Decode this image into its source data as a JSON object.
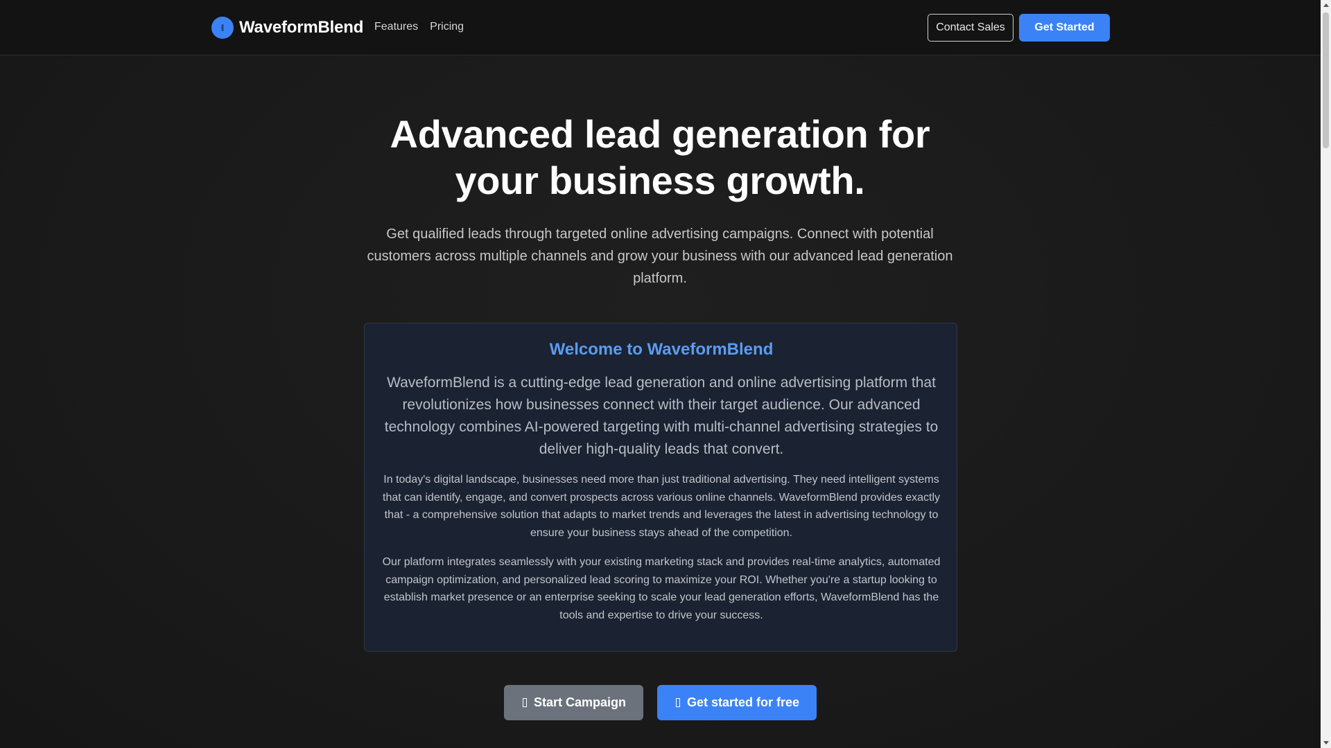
{
  "header": {
    "brand": "WaveformBlend",
    "nav": [
      {
        "label": "Features"
      },
      {
        "label": "Pricing"
      }
    ],
    "contact_label": "Contact Sales",
    "get_started_label": "Get Started"
  },
  "hero": {
    "title_line1": "Advanced lead generation for",
    "title_line2": "your business growth.",
    "subtitle": "Get qualified leads through targeted online advertising campaigns. Connect with potential customers across multiple channels and grow your business with our advanced lead generation platform."
  },
  "card": {
    "title": "Welcome to WaveformBlend",
    "lead": "WaveformBlend is a cutting-edge lead generation and online advertising platform that revolutionizes how businesses connect with their target audience. Our advanced technology combines AI-powered targeting with multi-channel advertising strategies to deliver high-quality leads that convert.",
    "p1": "In today's digital landscape, businesses need more than just traditional advertising. They need intelligent systems that can identify, engage, and convert prospects across various online channels. WaveformBlend provides exactly that - a comprehensive solution that adapts to market trends and leverages the latest in advertising technology to ensure your business stays ahead of the competition.",
    "p2": "Our platform integrates seamlessly with your existing marketing stack and provides real-time analytics, automated campaign optimization, and personalized lead scoring to maximize your ROI. Whether you're a startup looking to establish market presence or an enterprise seeking to scale your lead generation efforts, WaveformBlend has the tools and expertise to drive your success."
  },
  "cta": {
    "start_campaign_label": "Start Campaign",
    "get_started_free_label": "Get started for free"
  },
  "icons": {
    "logo": "logo-icon",
    "campaign": "rocket-icon",
    "free": "arrow-icon"
  },
  "colors": {
    "accent": "#3b82f6",
    "card_title": "#5b9cf0",
    "secondary_button": "#6c727b"
  }
}
